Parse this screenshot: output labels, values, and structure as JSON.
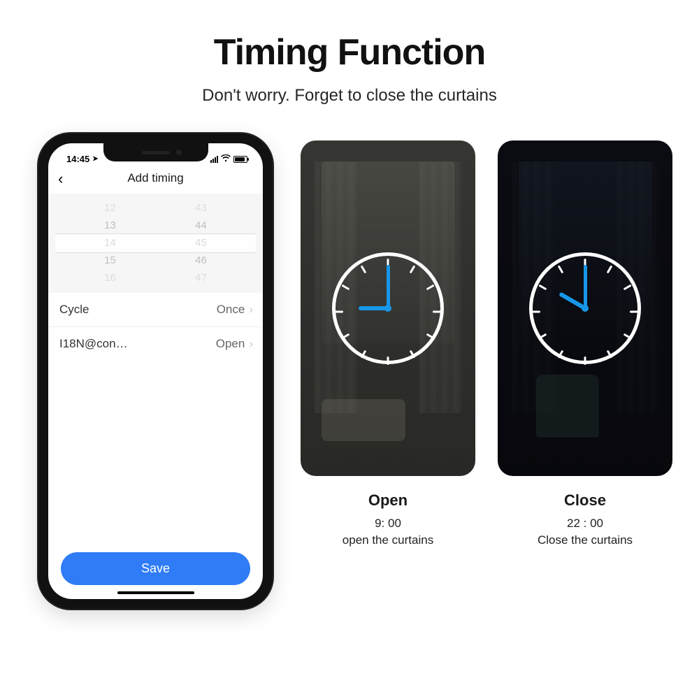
{
  "title": "Timing Function",
  "subtitle": "Don't worry. Forget to close the curtains",
  "phone": {
    "status_time": "14:45",
    "header_title": "Add timing",
    "picker": {
      "hours": [
        "12",
        "13",
        "14",
        "15",
        "16"
      ],
      "minutes": [
        "43",
        "44",
        "45",
        "46",
        "47"
      ],
      "selected_hour": "14",
      "selected_minute": "45"
    },
    "rows": [
      {
        "label": "Cycle",
        "value": "Once"
      },
      {
        "label": "I18N@con…",
        "value": "Open"
      }
    ],
    "save_label": "Save"
  },
  "cards": [
    {
      "variant": "light",
      "label": "Open",
      "time_text": "9: 00",
      "desc": "open the curtains",
      "hour_deg": 270,
      "minute_deg": 0
    },
    {
      "variant": "dark",
      "label": "Close",
      "time_text": "22 : 00",
      "desc": "Close the curtains",
      "hour_deg": 300,
      "minute_deg": 0
    }
  ]
}
